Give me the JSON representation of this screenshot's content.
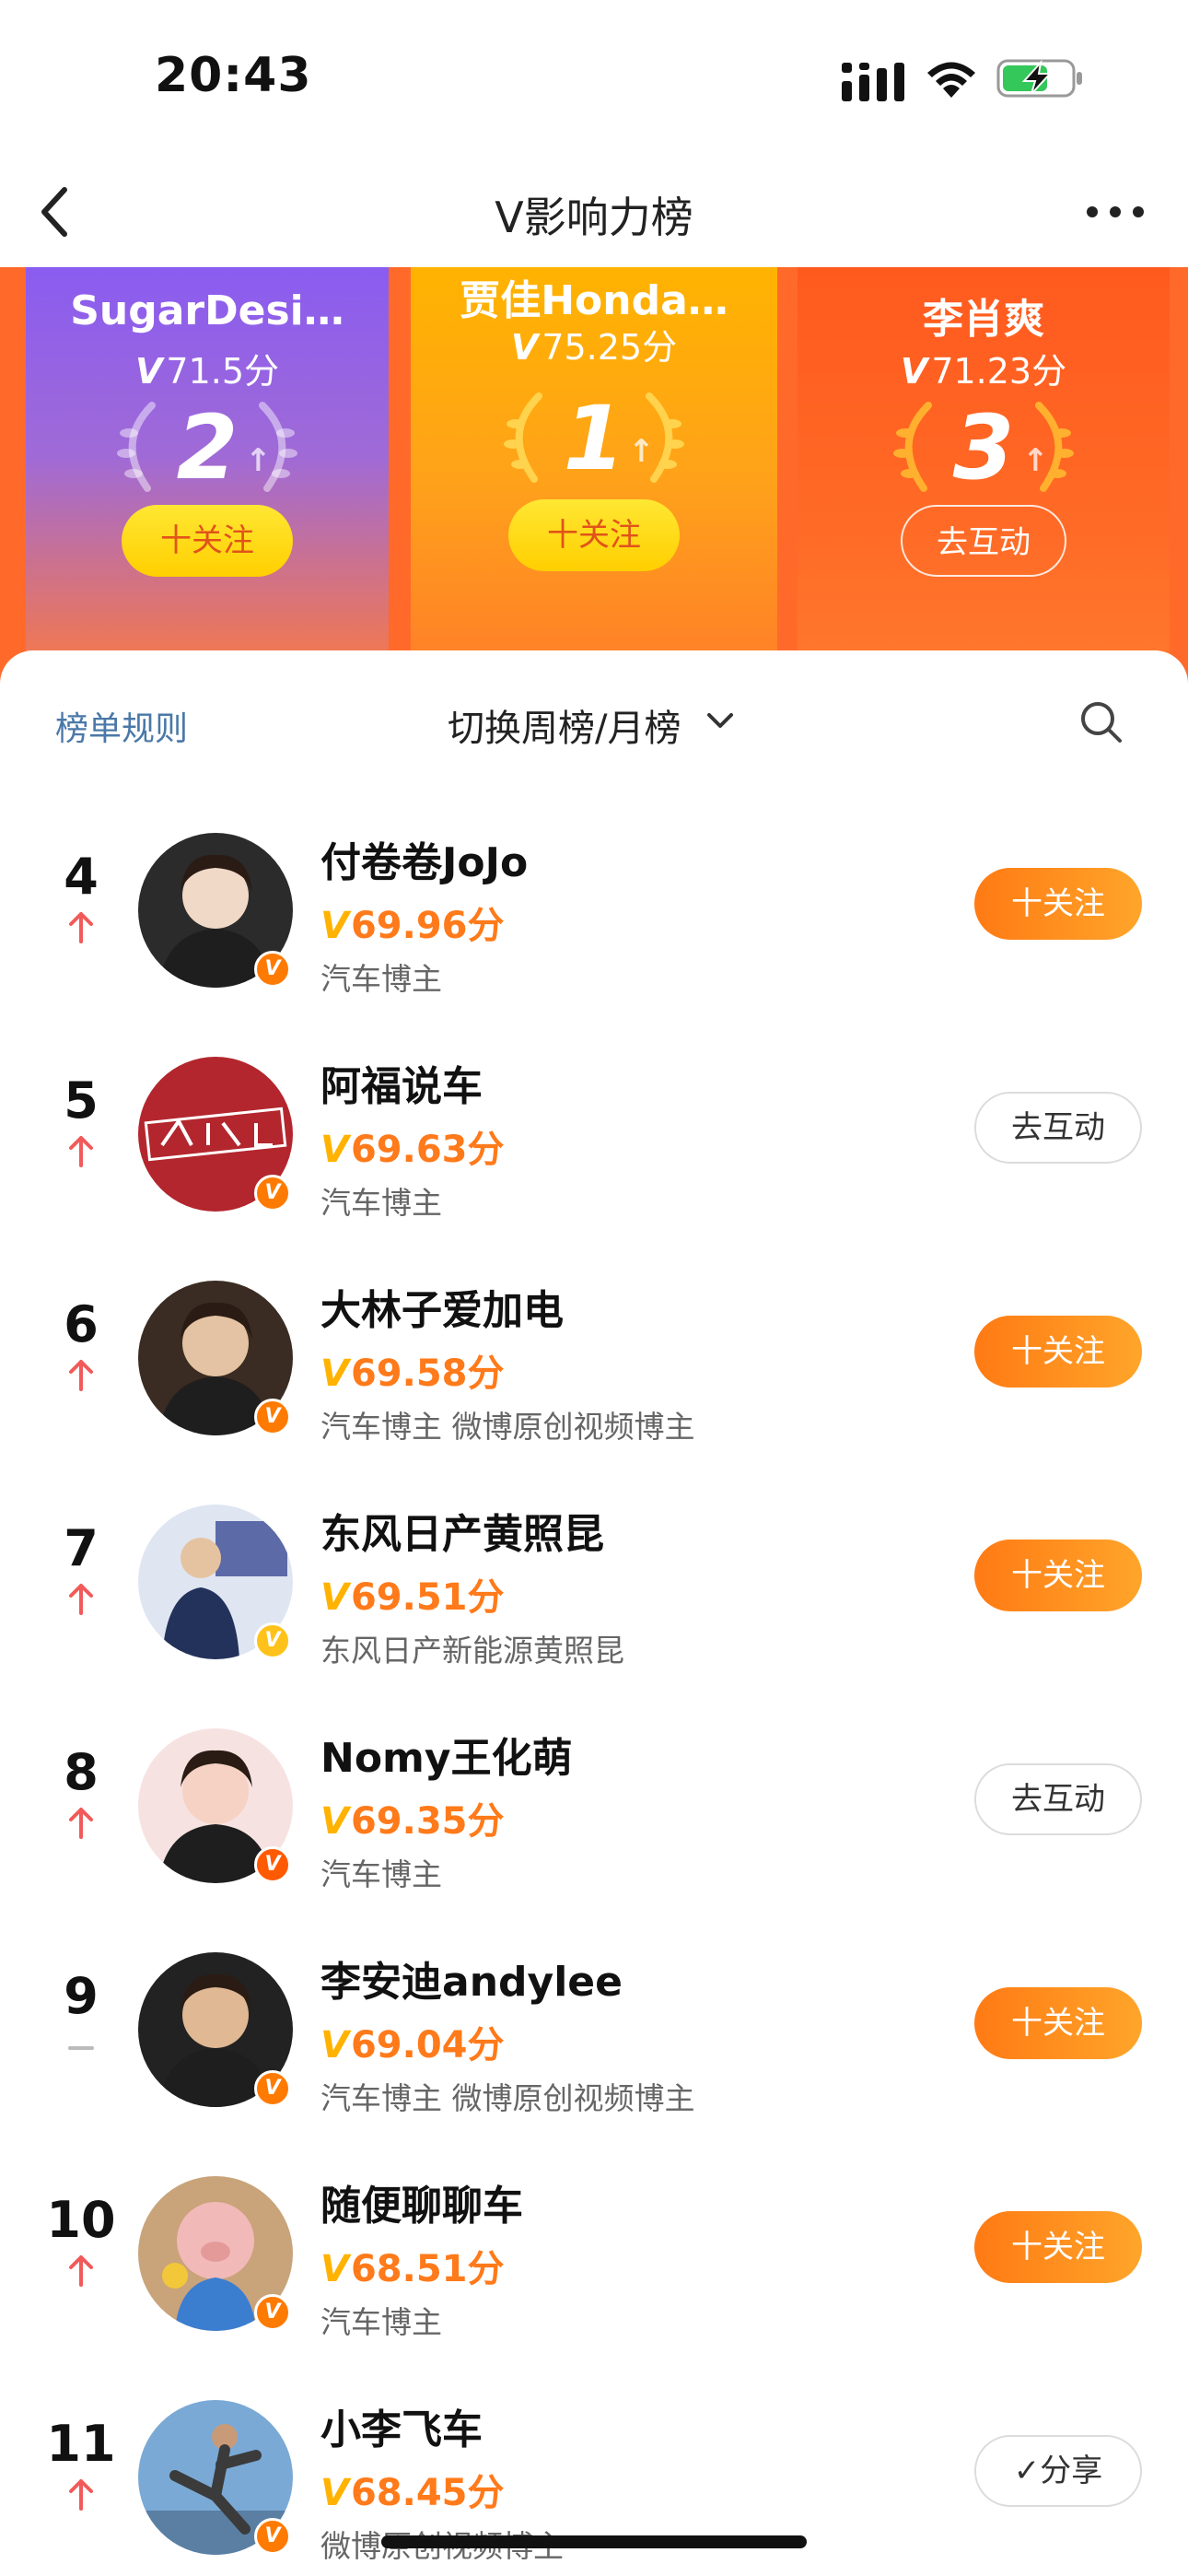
{
  "status_bar": {
    "time": "20:43"
  },
  "nav": {
    "title": "V影响力榜"
  },
  "podium": [
    {
      "position": "second",
      "name": "SugarDesi…",
      "score": "71.5分",
      "rank": "2",
      "button": "十关注"
    },
    {
      "position": "first",
      "name": "贾佳Honda…",
      "score": "75.25分",
      "rank": "1",
      "button": "十关注"
    },
    {
      "position": "third",
      "name": "李肖爽",
      "score": "71.23分",
      "rank": "3",
      "button": "去互动"
    }
  ],
  "sheet": {
    "rules_label": "榜单规则",
    "switch_label": "切换周榜/月榜"
  },
  "score_prefix": "V",
  "rows": [
    {
      "rank": "4",
      "trend": "up",
      "name": "付卷卷JoJo",
      "score": "69.96分",
      "desc": "汽车博主",
      "button": "十关注",
      "button_type": "follow",
      "badge": "orange"
    },
    {
      "rank": "5",
      "trend": "up",
      "name": "阿福说车",
      "score": "69.63分",
      "desc": "汽车博主",
      "button": "去互动",
      "button_type": "interact",
      "badge": "orange"
    },
    {
      "rank": "6",
      "trend": "up",
      "name": "大林子爱加电",
      "score": "69.58分",
      "desc": "汽车博主 微博原创视频博主",
      "button": "十关注",
      "button_type": "follow",
      "badge": "orange"
    },
    {
      "rank": "7",
      "trend": "up",
      "name": "东风日产黄照昆",
      "score": "69.51分",
      "desc": "东风日产新能源黄照昆",
      "button": "十关注",
      "button_type": "follow",
      "badge": "gold"
    },
    {
      "rank": "8",
      "trend": "up",
      "name": "Nomy王化萌",
      "score": "69.35分",
      "desc": "汽车博主",
      "button": "去互动",
      "button_type": "interact",
      "badge": "red"
    },
    {
      "rank": "9",
      "trend": "flat",
      "name": "李安迪andylee",
      "score": "69.04分",
      "desc": "汽车博主 微博原创视频博主",
      "button": "十关注",
      "button_type": "follow",
      "badge": "orange"
    },
    {
      "rank": "10",
      "trend": "up",
      "name": "随便聊聊车",
      "score": "68.51分",
      "desc": "汽车博主",
      "button": "十关注",
      "button_type": "follow",
      "badge": "orange"
    },
    {
      "rank": "11",
      "trend": "up",
      "name": "小李飞车",
      "score": "68.45分",
      "desc": "微博原创视频博主",
      "button": "✓分享",
      "button_type": "interact",
      "badge": "orange"
    }
  ],
  "colors": {
    "accent": "#ff7a1a",
    "follow_gradient_start": "#ff7a14",
    "follow_gradient_end": "#ffa52a",
    "rank_up": "#f25a5a",
    "badge_orange": "#ff7a00",
    "badge_gold": "#ffc21a",
    "badge_red": "#ff5a00"
  }
}
